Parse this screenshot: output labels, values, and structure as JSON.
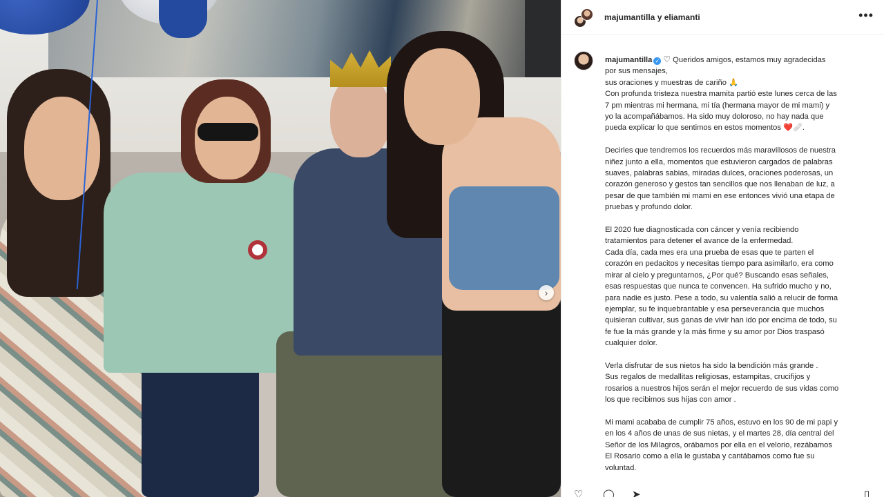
{
  "header": {
    "users": "majumantilla y eliamanti",
    "more_icon": "more-horizontal-icon"
  },
  "photo": {
    "carousel_next": "›"
  },
  "caption": {
    "username": "majumantilla",
    "verified_icon": "✓",
    "heart_icon": "♡",
    "paragraphs": [
      {
        "lines": [
          "Queridos amigos, estamos muy agradecidas",
          "por sus mensajes,",
          "sus oraciones y muestras de cariño 🙏",
          "Con profunda tristeza nuestra mamita partió este lunes cerca de las",
          "7 pm mientras mi hermana, mi tía (hermana mayor de mi mami) y",
          "yo la acompañábamos. Ha sido muy doloroso, no hay nada que",
          "pueda explicar lo que sentimos en estos momentos ❤️🩹."
        ]
      },
      {
        "lines": [
          "Decirles que tendremos los recuerdos  más maravillosos de nuestra",
          "niñez junto a ella, momentos que estuvieron cargados de palabras",
          "suaves, palabras sabias, miradas dulces, oraciones poderosas, un",
          "corazón generoso y gestos tan sencillos que nos llenaban de luz, a",
          "pesar de que también mi mami en ese entonces vivió una etapa de",
          "pruebas y profundo dolor."
        ]
      },
      {
        "lines": [
          "El 2020 fue diagnosticada con cáncer y venía recibiendo",
          "tratamientos para detener el avance de la enfermedad.",
          "Cada día, cada mes era una prueba de esas que te parten el",
          "corazón en pedacitos y necesitas tiempo para asimilarlo, era como",
          "mirar al cielo y preguntarnos, ¿Por qué? Buscando esas señales,",
          "esas respuestas que nunca te convencen. Ha sufrido mucho y no,",
          "para nadie es justo. Pese a todo, su valentía salió a relucir de forma",
          "ejemplar, su fe inquebrantable y esa perseverancia que muchos",
          "quisieran cultivar, sus ganas de vivir han ido por encima de todo, su",
          "fe fue la más grande y la más firme y su amor por Dios traspasó",
          "cualquier dolor."
        ]
      },
      {
        "lines": [
          "Verla disfrutar de sus nietos ha sido la bendición más grande .",
          "Sus regalos de medallitas religiosas, estampitas, crucifijos y",
          "rosarios a nuestros hijos serán el mejor recuerdo de sus vidas como",
          "los que recibimos sus hijas con amor ."
        ]
      },
      {
        "lines": [
          "Mi mami acababa de cumplir 75 años, estuvo en los 90 de mi papi y",
          "en los 4 años de unas de sus nietas, y el martes 28, día central del",
          "Señor de los Milagros, orábamos por ella en el velorio, rezábamos",
          "El Rosario como a ella le gustaba y cantábamos como fue su",
          "voluntad."
        ]
      }
    ]
  },
  "actions": {
    "like_icon": "heart-icon",
    "comment_icon": "comment-icon",
    "share_icon": "share-icon",
    "save_icon": "bookmark-icon"
  },
  "colors": {
    "verified": "#3897f0",
    "text": "#262626",
    "heart": "#e1342c"
  }
}
